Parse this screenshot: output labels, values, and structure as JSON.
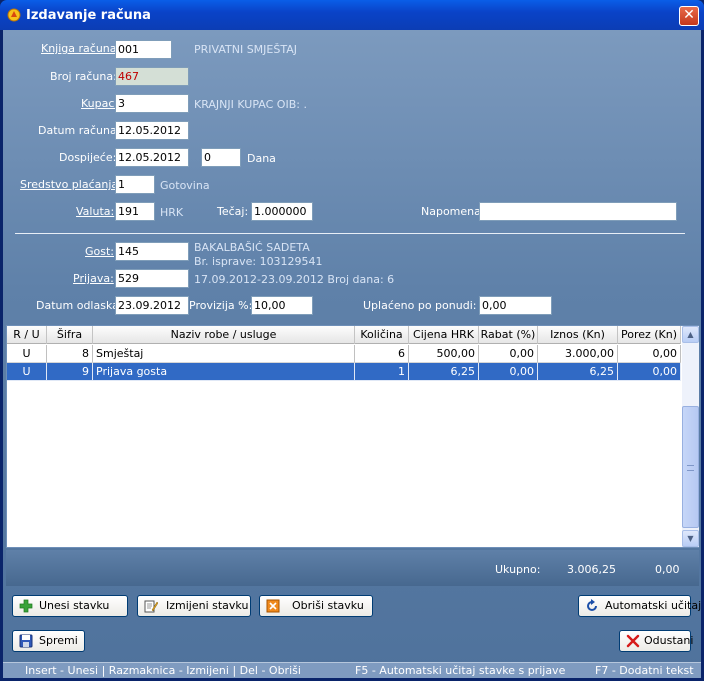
{
  "window": {
    "title": "Izdavanje računa"
  },
  "form": {
    "knjiga_label": "Knjiga računa:",
    "knjiga_value": "001",
    "knjiga_info": "PRIVATNI SMJEŠTAJ",
    "broj_label": "Broj računa:",
    "broj_value": "467",
    "kupac_label": "Kupac:",
    "kupac_value": "3",
    "kupac_info": "KRAJNJI KUPAC OIB: .",
    "datum_label": "Datum računa:",
    "datum_value": "12.05.2012",
    "dospijece_label": "Dospijeće:",
    "dospijece_value": "12.05.2012",
    "dana_value": "0",
    "dana_label": "Dana",
    "sredstvo_label": "Sredstvo plaćanja:",
    "sredstvo_value": "1",
    "sredstvo_info": "Gotovina",
    "valuta_label": "Valuta:",
    "valuta_value": "191",
    "valuta_info": "HRK",
    "tecaj_label": "Tečaj:",
    "tecaj_value": "1.000000",
    "napomena_label": "Napomena:",
    "napomena_value": "",
    "gost_label": "Gost:",
    "gost_value": "145",
    "gost_info1": "BAKALBAŠIĆ SADETA",
    "gost_info2": "Br. isprave: 103129541",
    "prijava_label": "Prijava:",
    "prijava_value": "529",
    "prijava_info": "17.09.2012-23.09.2012 Broj dana: 6",
    "odlazak_label": "Datum odlaska:",
    "odlazak_value": "23.09.2012",
    "provizija_label": "Provizija %:",
    "provizija_value": "10,00",
    "uplaceno_label": "Uplaćeno po ponudi:",
    "uplaceno_value": "0,00"
  },
  "grid": {
    "headers": [
      "R / U",
      "Šifra",
      "Naziv robe / usluge",
      "Količina",
      "Cijena HRK",
      "Rabat (%)",
      "Iznos (Kn)",
      "Porez (Kn)"
    ],
    "rows": [
      {
        "ru": "U",
        "sifra": "8",
        "naziv": "Smještaj",
        "kolicina": "6",
        "cijena": "500,00",
        "rabat": "0,00",
        "iznos": "3.000,00",
        "porez": "0,00"
      },
      {
        "ru": "U",
        "sifra": "9",
        "naziv": "Prijava gosta",
        "kolicina": "1",
        "cijena": "6,25",
        "rabat": "0,00",
        "iznos": "6,25",
        "porez": "0,00"
      }
    ]
  },
  "totals": {
    "label": "Ukupno:",
    "iznos": "3.006,25",
    "porez": "0,00"
  },
  "buttons": {
    "unesi": "Unesi stavku",
    "izmijeni": "Izmijeni stavku",
    "obrisi": "Obriši stavku",
    "automatski": "Automatski učitaj",
    "spremi": "Spremi",
    "odustani": "Odustani"
  },
  "status": {
    "seg1": "Insert - Unesi  |  Razmaknica - Izmijeni  |  Del - Obriši",
    "seg2": "F5 - Automatski učitaj stavke s prijave",
    "seg3": "F7 - Dodatni tekst"
  },
  "colors": {
    "titlebar": "#0a43c8",
    "panel": "#5f81a9",
    "selected_row": "#316ac5",
    "readonly_value": "#c00000"
  }
}
